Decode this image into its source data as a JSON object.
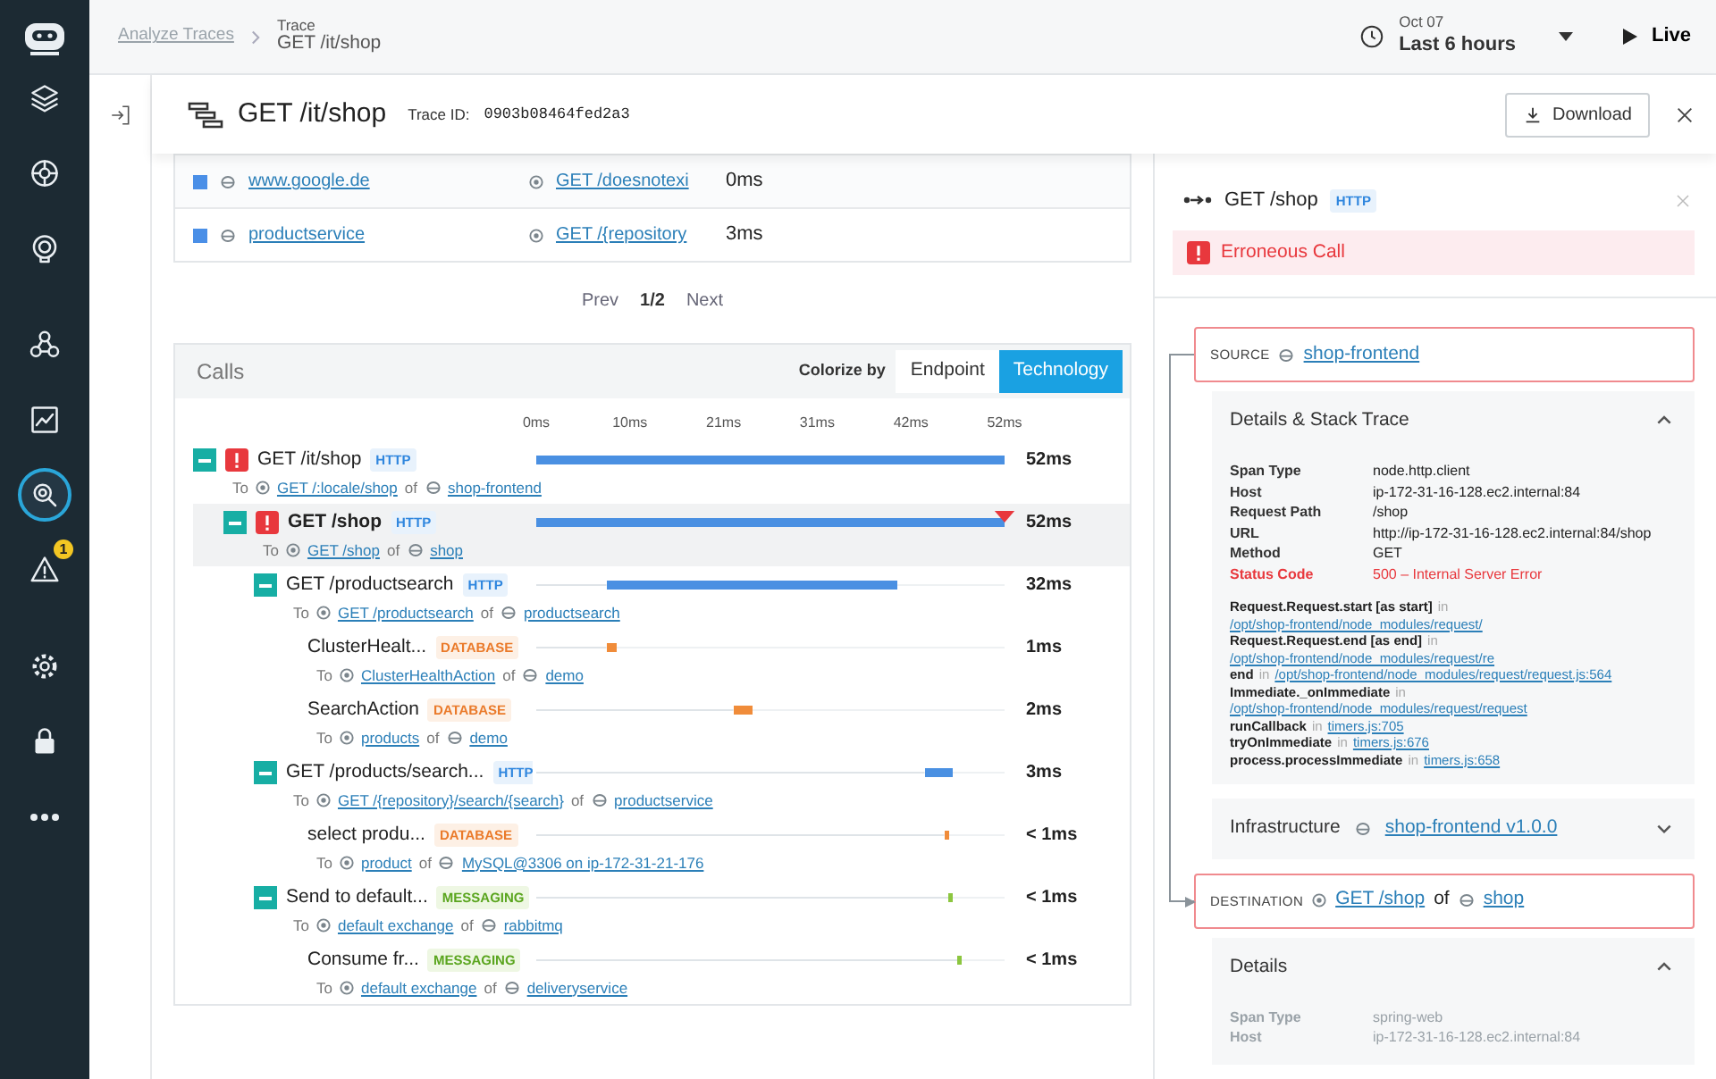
{
  "sidebar": {
    "items": [
      {
        "kind": "layers",
        "selected": false
      },
      {
        "kind": "cog",
        "selected": false
      },
      {
        "kind": "target",
        "selected": false
      },
      {
        "kind": "network",
        "selected": false
      },
      {
        "kind": "chart",
        "selected": false
      },
      {
        "kind": "search",
        "selected": true
      },
      {
        "kind": "warning",
        "selected": false,
        "badge": "1"
      },
      {
        "kind": "settings",
        "selected": false
      },
      {
        "kind": "lock",
        "selected": false
      },
      {
        "kind": "more",
        "selected": false
      }
    ]
  },
  "topbar": {
    "parent": "Analyze Traces",
    "label": "Trace",
    "title": "GET /it/shop",
    "date": "Oct 07",
    "range": "Last 6 hours",
    "live": "Live"
  },
  "header": {
    "title": "GET /it/shop",
    "trace_id_label": "Trace ID:",
    "trace_id": "0903b08464fed2a3",
    "download": "Download"
  },
  "services": {
    "rows": [
      {
        "color": "#4a8fe7",
        "service": "www.google.de",
        "endpoint": "GET /doesnotexi",
        "duration": "0ms"
      },
      {
        "color": "#4a8fe7",
        "service": "productservice",
        "endpoint": "GET /{repository",
        "duration": "3ms"
      }
    ]
  },
  "pagination": {
    "prev": "Prev",
    "page": "1/2",
    "next": "Next"
  },
  "calls": {
    "title": "Calls",
    "colorize_label": "Colorize by",
    "colorize_options": [
      {
        "label": "Endpoint",
        "selected": false
      },
      {
        "label": "Technology",
        "selected": true
      }
    ],
    "timeline_ticks": [
      "0ms",
      "10ms",
      "21ms",
      "31ms",
      "42ms",
      "52ms"
    ],
    "items": [
      {
        "name": "GET /it/shop",
        "tag": "HTTP",
        "error": true,
        "expanded": true,
        "selected": false,
        "bar_start": {
          "level": 0
        },
        "bar_end": {
          "level": 1
        },
        "to": "To",
        "endpoint": "GET /:locale/shop",
        "of": "of",
        "service": "shop-frontend",
        "duration": "52ms",
        "children": [
          {
            "name": "GET /shop",
            "tag": "HTTP",
            "error": true,
            "expanded": true,
            "selected": true,
            "bar_start": {
              "level": 0
            },
            "bar_end": {
              "level": 1
            },
            "to": "To",
            "endpoint": "GET /shop",
            "of": "of",
            "service": "shop",
            "duration": "52ms",
            "children": [
              {
                "name": "GET /productsearch",
                "tag": "HTTP",
                "error": false,
                "expanded": true,
                "selected": false,
                "bar_start": {
                  "level": 0.15
                },
                "bar_end": {
                  "level": 0.77
                },
                "to": "To",
                "endpoint": "GET /productsearch",
                "of": "of",
                "service": "productsearch",
                "duration": "32ms",
                "children": [
                  {
                    "name": "ClusterHealt...",
                    "tag": "DATABASE",
                    "error": false,
                    "selected": false,
                    "bar_start": {
                      "level": 0.15
                    },
                    "bar_end": {
                      "level": 0.17
                    },
                    "to": "To",
                    "endpoint": "ClusterHealthAction",
                    "of": "of",
                    "service": "demo",
                    "duration": "1ms"
                  },
                  {
                    "name": "SearchAction",
                    "tag": "DATABASE",
                    "error": false,
                    "selected": false,
                    "bar_start": {
                      "level": 0.42
                    },
                    "bar_end": {
                      "level": 0.46
                    },
                    "to": "To",
                    "endpoint": "products",
                    "of": "of",
                    "service": "demo",
                    "duration": "2ms"
                  }
                ]
              },
              {
                "name": "GET /products/search...",
                "tag": "HTTP",
                "error": false,
                "expanded": true,
                "selected": false,
                "bar_start": {
                  "level": 0.83
                },
                "bar_end": {
                  "level": 0.89
                },
                "to": "To",
                "endpoint": "GET /{repository}/search/{search}",
                "of": "of",
                "service": "productservice",
                "duration": "3ms",
                "children": [
                  {
                    "name": "select produ...",
                    "tag": "DATABASE",
                    "error": false,
                    "selected": false,
                    "bar_start": {
                      "level": 0.87
                    },
                    "bar_end": {
                      "level": 0.88
                    },
                    "to": "To",
                    "endpoint": "product",
                    "of": "of",
                    "service": "MySQL@3306 on ip-172-31-21-176",
                    "duration": "< 1ms"
                  }
                ]
              },
              {
                "name": "Send to default...",
                "tag": "MESSAGING",
                "error": false,
                "expanded": true,
                "selected": false,
                "bar_start": {
                  "level": 0.88
                },
                "bar_end": {
                  "level": 0.89
                },
                "to": "To",
                "endpoint": "default exchange",
                "of": "of",
                "service": "rabbitmq",
                "duration": "< 1ms",
                "children": [
                  {
                    "name": "Consume fr...",
                    "tag": "MESSAGING",
                    "error": false,
                    "selected": false,
                    "bar_start": {
                      "level": 0.9
                    },
                    "bar_end": {
                      "level": 0.91
                    },
                    "to": "To",
                    "endpoint": "default exchange",
                    "of": "of",
                    "service": "deliveryservice",
                    "duration": "< 1ms"
                  }
                ]
              }
            ]
          }
        ]
      }
    ]
  },
  "detail": {
    "title": "GET /shop",
    "tag": "HTTP",
    "banner": "Erroneous Call",
    "source": {
      "label": "SOURCE",
      "service": "shop-frontend"
    },
    "details": {
      "title": "Details & Stack Trace",
      "expanded": true,
      "fields": [
        {
          "key": "Span Type",
          "value": "node.http.client",
          "error": false
        },
        {
          "key": "Host",
          "value": "ip-172-31-16-128.ec2.internal:84",
          "error": false
        },
        {
          "key": "Request Path",
          "value": "/shop",
          "error": false
        },
        {
          "key": "URL",
          "value": "http://ip-172-31-16-128.ec2.internal:84/shop",
          "error": false
        },
        {
          "key": "Method",
          "value": "GET",
          "error": false
        },
        {
          "key": "Status Code",
          "value": "500 – Internal Server Error",
          "error": true
        }
      ],
      "stack": [
        {
          "fn": "Request.Request.start [as start]",
          "in": "in",
          "location": "/opt/shop-frontend/node_modules/request/"
        },
        {
          "fn": "Request.Request.end [as end]",
          "in": "in",
          "location": "/opt/shop-frontend/node_modules/request/re"
        },
        {
          "fn": "end",
          "in": "in",
          "location": "/opt/shop-frontend/node_modules/request/request.js:564"
        },
        {
          "fn": "Immediate._onImmediate",
          "in": "in",
          "location": "/opt/shop-frontend/node_modules/request/request"
        },
        {
          "fn": "runCallback",
          "in": "in",
          "location": "timers.js:705"
        },
        {
          "fn": "tryOnImmediate",
          "in": "in",
          "location": "timers.js:676"
        },
        {
          "fn": "process.processImmediate",
          "in": "in",
          "location": "timers.js:658"
        }
      ]
    },
    "infrastructure": {
      "title": "Infrastructure",
      "value": "shop-frontend v1.0.0",
      "expanded": false
    },
    "destination": {
      "label": "DESTINATION",
      "endpoint": "GET /shop",
      "of": "of",
      "service": "shop"
    },
    "details2": {
      "title": "Details",
      "expanded": true,
      "fields": [
        {
          "key": "Span Type",
          "value": "spring-web",
          "error": false
        },
        {
          "key": "Host",
          "value": "ip-172-31-16-128.ec2.internal:84",
          "error": false
        }
      ]
    }
  }
}
